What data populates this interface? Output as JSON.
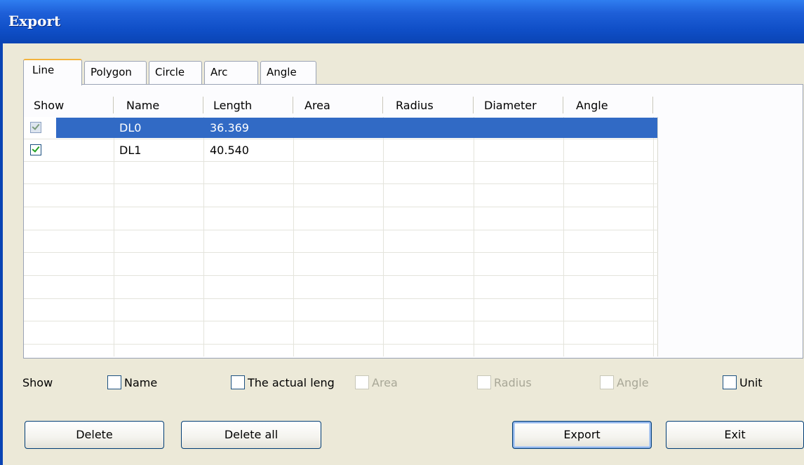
{
  "window": {
    "title": "Export"
  },
  "tabs": [
    {
      "label": "Line",
      "active": true
    },
    {
      "label": "Polygon",
      "active": false
    },
    {
      "label": "Circle",
      "active": false
    },
    {
      "label": "Arc",
      "active": false
    },
    {
      "label": "Angle",
      "active": false
    }
  ],
  "table": {
    "columns": [
      "Show",
      "Name",
      "Length",
      "Area",
      "Radius",
      "Diameter",
      "Angle"
    ],
    "rows": [
      {
        "show": true,
        "name": "DL0",
        "length": "36.369",
        "area": "",
        "radius": "",
        "diameter": "",
        "angle": "",
        "selected": true
      },
      {
        "show": true,
        "name": "DL1",
        "length": "40.540",
        "area": "",
        "radius": "",
        "diameter": "",
        "angle": "",
        "selected": false
      }
    ]
  },
  "options": {
    "show_label": "Show",
    "items": [
      {
        "label": "Name",
        "checked": false,
        "enabled": true
      },
      {
        "label": "The actual leng",
        "checked": false,
        "enabled": true
      },
      {
        "label": "Area",
        "checked": false,
        "enabled": false
      },
      {
        "label": "Radius",
        "checked": false,
        "enabled": false
      },
      {
        "label": "Angle",
        "checked": false,
        "enabled": false
      },
      {
        "label": "Unit",
        "checked": false,
        "enabled": true
      }
    ]
  },
  "buttons": {
    "delete": "Delete",
    "delete_all": "Delete all",
    "export": "Export",
    "exit": "Exit"
  },
  "colors": {
    "titlebar": "#0f4ec6",
    "selection": "#316ac5",
    "dialog_bg": "#ece9d8",
    "tab_accent": "#f3b33d",
    "check_green": "#21a121"
  }
}
